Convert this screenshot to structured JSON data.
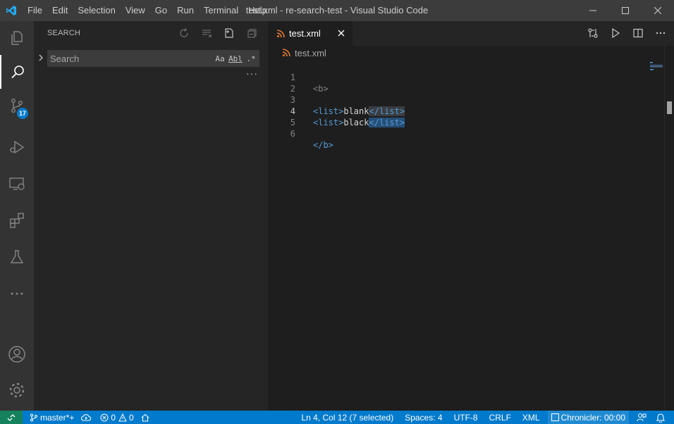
{
  "window": {
    "title": "test.xml - re-search-test - Visual Studio Code",
    "menu": [
      "File",
      "Edit",
      "Selection",
      "View",
      "Go",
      "Run",
      "Terminal",
      "Help"
    ]
  },
  "activity_bar": {
    "items": [
      "explorer-icon",
      "search-icon",
      "source-control-icon",
      "run-debug-icon",
      "remote-explorer-icon",
      "extensions-icon",
      "testing-icon",
      "more-icon",
      "accounts-icon",
      "settings-gear-icon"
    ],
    "source_control_badge": "17"
  },
  "sidebar": {
    "title": "SEARCH",
    "search": {
      "placeholder": "Search",
      "value": ""
    },
    "options": {
      "match_case": "Aa",
      "whole_word": "Abl",
      "regex": ".*"
    },
    "more": "···"
  },
  "editor": {
    "tab": {
      "label": "test.xml"
    },
    "breadcrumb": "test.xml",
    "line_numbers": [
      "1",
      "2",
      "3",
      "4",
      "5",
      "6"
    ],
    "lines": [
      {
        "open_tag": "<b>"
      },
      {},
      {
        "open_tag": "<list>",
        "text": "blank",
        "close_tag": "</list>"
      },
      {
        "open_tag": "<list>",
        "text": "black",
        "close_tag": "</list>"
      },
      {},
      {
        "close_tag": "</b>"
      }
    ]
  },
  "status_bar": {
    "branch": "master*+",
    "errors": "0",
    "warnings": "0",
    "cursor": "Ln 4, Col 12 (7 selected)",
    "indent": "Spaces: 4",
    "encoding": "UTF-8",
    "eol": "CRLF",
    "language": "XML",
    "chronicler": "Chronicler: 00:00"
  },
  "colors": {
    "title_bar": "#3c3c3c",
    "activity_bar": "#333333",
    "sidebar": "#252526",
    "editor": "#1e1e1e",
    "status_bar": "#007acc",
    "remote_indicator": "#16825d",
    "tag": "#569cd6",
    "selection": "#264f78"
  }
}
